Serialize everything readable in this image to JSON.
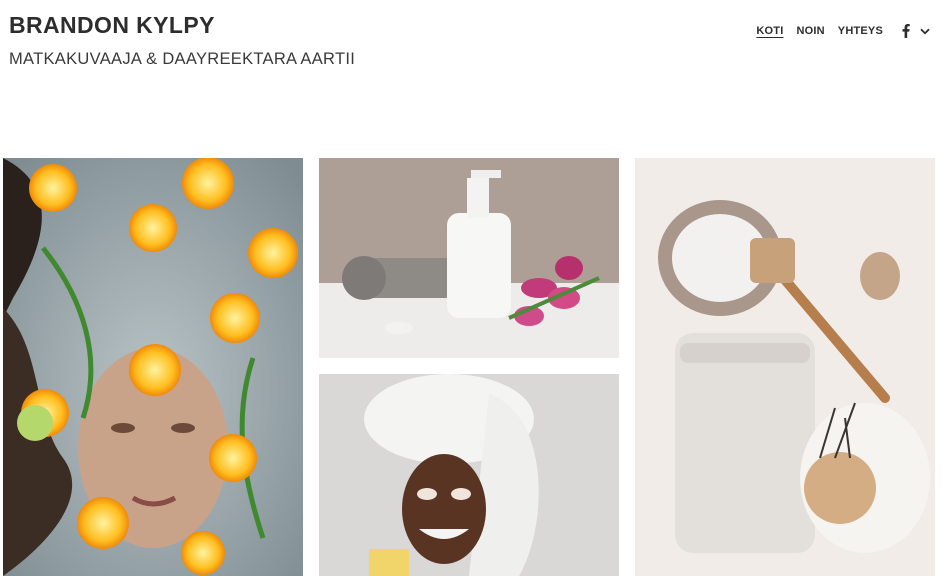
{
  "site": {
    "title": "BRANDON KYLPY",
    "tagline": "MATKAKUVAAJA & DAAYREEKTARA AARTII"
  },
  "nav": {
    "items": [
      {
        "label": "KOTI",
        "active": true
      },
      {
        "label": "NOIN",
        "active": false
      },
      {
        "label": "YHTEYS",
        "active": false
      }
    ],
    "social_icon": "facebook-icon",
    "dropdown_icon": "chevron-down-icon"
  },
  "gallery": {
    "photos": [
      {
        "name": "bath-with-orange-slices-photo"
      },
      {
        "name": "towel-and-lotion-bottle-photo"
      },
      {
        "name": "face-mask-woman-photo"
      },
      {
        "name": "salt-bowl-and-towel-photo"
      }
    ]
  },
  "colors": {
    "text": "#2d2d2d",
    "background": "#ffffff"
  }
}
